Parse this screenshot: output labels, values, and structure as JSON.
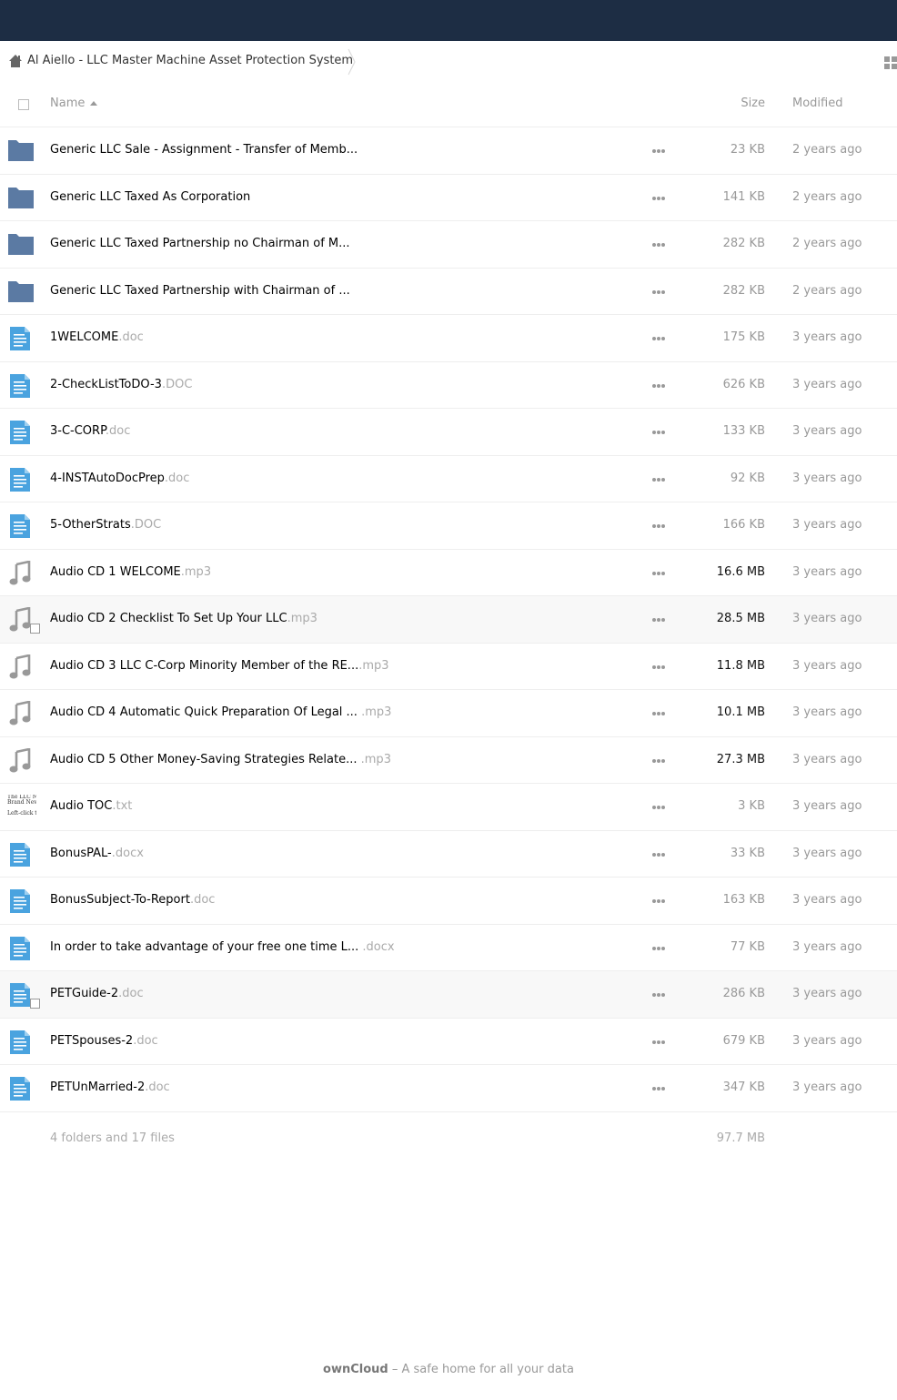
{
  "breadcrumb": {
    "home_icon": "home-icon",
    "folder": "Al Aiello - LLC Master Machine Asset Protection System"
  },
  "view_toggle_icon": "grid-view-icon",
  "header": {
    "name": "Name",
    "size": "Size",
    "modified": "Modified"
  },
  "files": [
    {
      "type": "folder",
      "name": "Generic LLC Sale - Assignment - Transfer of Memb...",
      "ext": "",
      "size": "23 KB",
      "modified": "2 years ago"
    },
    {
      "type": "folder",
      "name": "Generic LLC Taxed As Corporation",
      "ext": "",
      "size": "141 KB",
      "modified": "2 years ago"
    },
    {
      "type": "folder",
      "name": "Generic LLC Taxed Partnership no Chairman of M...",
      "ext": "",
      "size": "282 KB",
      "modified": "2 years ago"
    },
    {
      "type": "folder",
      "name": "Generic LLC Taxed Partnership with Chairman of ...",
      "ext": "",
      "size": "282 KB",
      "modified": "2 years ago"
    },
    {
      "type": "doc",
      "name": "1WELCOME",
      "ext": ".doc",
      "size": "175 KB",
      "modified": "3 years ago"
    },
    {
      "type": "doc",
      "name": "2-CheckListToDO-3",
      "ext": ".DOC",
      "size": "626 KB",
      "modified": "3 years ago"
    },
    {
      "type": "doc",
      "name": "3-C-CORP",
      "ext": ".doc",
      "size": "133 KB",
      "modified": "3 years ago"
    },
    {
      "type": "doc",
      "name": "4-INSTAutoDocPrep",
      "ext": ".doc",
      "size": "92 KB",
      "modified": "3 years ago"
    },
    {
      "type": "doc",
      "name": "5-OtherStrats",
      "ext": ".DOC",
      "size": "166 KB",
      "modified": "3 years ago"
    },
    {
      "type": "audio",
      "name": "Audio CD 1 WELCOME",
      "ext": ".mp3",
      "size": "16.6 MB",
      "modified": "3 years ago"
    },
    {
      "type": "audio",
      "name": "Audio CD 2 Checklist To Set Up Your LLC",
      "ext": ".mp3",
      "size": "28.5 MB",
      "modified": "3 years ago",
      "hovered": true
    },
    {
      "type": "audio",
      "name": "Audio CD 3 LLC C-Corp Minority Member of the RE...",
      "ext": ".mp3",
      "size": "11.8 MB",
      "modified": "3 years ago"
    },
    {
      "type": "audio",
      "name": "Audio CD 4 Automatic Quick Preparation Of Legal ... ",
      "ext": ".mp3",
      "size": "10.1 MB",
      "modified": "3 years ago"
    },
    {
      "type": "audio",
      "name": "Audio CD 5 Other Money-Saving Strategies Relate... ",
      "ext": ".mp3",
      "size": "27.3 MB",
      "modified": "3 years ago"
    },
    {
      "type": "txt",
      "name": "Audio TOC",
      "ext": ".txt",
      "size": "3 KB",
      "modified": "3 years ago",
      "thumb": [
        "The LLC M",
        "Brand Nev",
        "",
        "Left-click t"
      ]
    },
    {
      "type": "doc",
      "name": "BonusPAL-",
      "ext": ".docx",
      "size": "33 KB",
      "modified": "3 years ago"
    },
    {
      "type": "doc",
      "name": "BonusSubject-To-Report",
      "ext": ".doc",
      "size": "163 KB",
      "modified": "3 years ago"
    },
    {
      "type": "doc",
      "name": "In order to take advantage of your free one time L... ",
      "ext": ".docx",
      "size": "77 KB",
      "modified": "3 years ago"
    },
    {
      "type": "doc",
      "name": "PETGuide-2",
      "ext": ".doc",
      "size": "286 KB",
      "modified": "3 years ago",
      "hovered": true
    },
    {
      "type": "doc",
      "name": "PETSpouses-2",
      "ext": ".doc",
      "size": "679 KB",
      "modified": "3 years ago"
    },
    {
      "type": "doc",
      "name": "PETUnMarried-2",
      "ext": ".doc",
      "size": "347 KB",
      "modified": "3 years ago"
    }
  ],
  "summary": {
    "label": "4 folders and 17 files",
    "total_size": "97.7 MB"
  },
  "footer": {
    "brand": "ownCloud",
    "tagline": " – A safe home for all your data"
  },
  "colors": {
    "topbar": "#1d2d44",
    "folder": "#5b7aa3",
    "doc": "#4aa3df",
    "audio": "#999999"
  }
}
